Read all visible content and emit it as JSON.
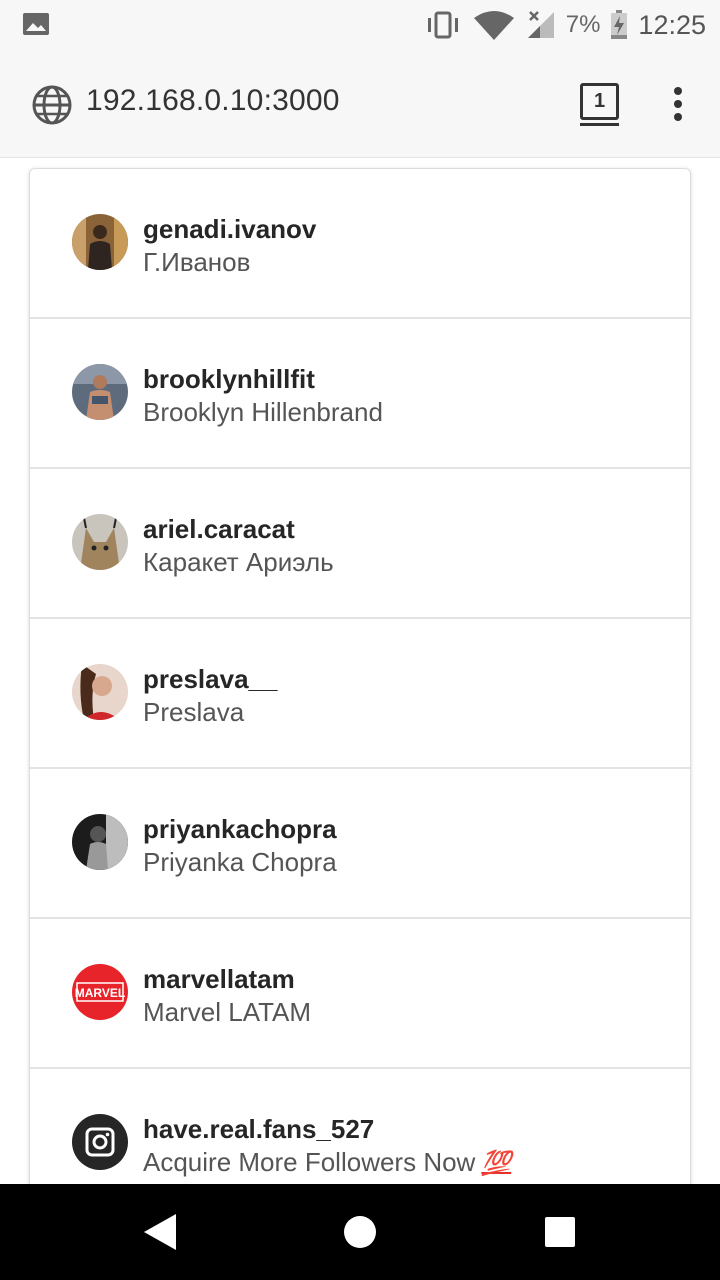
{
  "status_bar": {
    "battery_percent": "7%",
    "time": "12:25",
    "icons": [
      "image-icon",
      "vibrate-icon",
      "wifi-icon",
      "cell-signal-icon",
      "battery-charging-icon"
    ]
  },
  "address_bar": {
    "url": "192.168.0.10:3000",
    "tab_count": "1",
    "icons": [
      "globe-icon",
      "more-vert-icon"
    ]
  },
  "list": {
    "items": [
      {
        "username": "genadi.ivanov",
        "fullname": "Г.Иванов",
        "avatar_color": "#7a5a3a"
      },
      {
        "username": "brooklynhillfit",
        "fullname": "Brooklyn Hillenbrand",
        "avatar_color": "#6f7c8c"
      },
      {
        "username": "ariel.caracat",
        "fullname": "Каракет Ариэль",
        "avatar_color": "#a08a6a"
      },
      {
        "username": "preslava__",
        "fullname": "Preslava",
        "avatar_color": "#c8483a"
      },
      {
        "username": "priyankachopra",
        "fullname": "Priyanka Chopra",
        "avatar_color": "#2b2b2b"
      },
      {
        "username": "marvellatam",
        "fullname": "Marvel LATAM",
        "avatar_color": "#e62429",
        "avatar_text": "MARVEL"
      },
      {
        "username": "have.real.fans_527",
        "fullname": "Acquire More Followers Now",
        "fullname_emoji": "💯",
        "avatar_color": "#262626"
      }
    ]
  },
  "nav_bar": {
    "icons": [
      "back-icon",
      "home-icon",
      "recents-icon"
    ]
  }
}
